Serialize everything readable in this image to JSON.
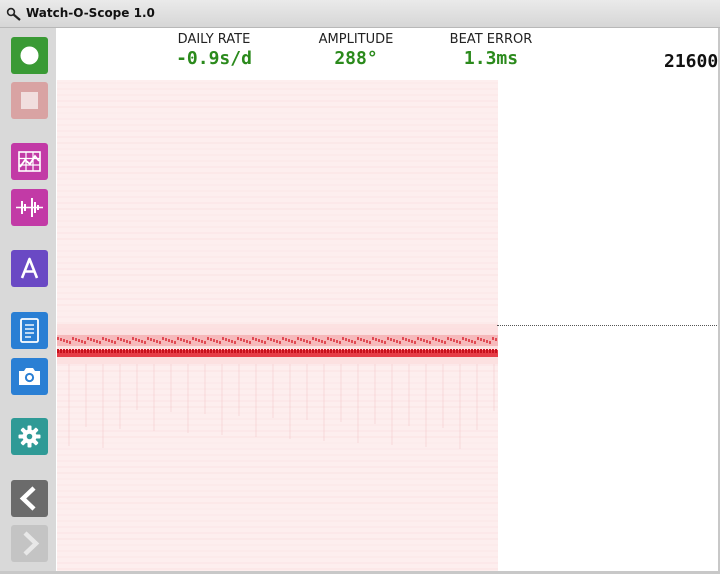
{
  "window": {
    "title": "Watch-O-Scope 1.0"
  },
  "readouts": {
    "daily_rate": {
      "label": "DAILY RATE",
      "value": "-0.9s/d"
    },
    "amplitude": {
      "label": "AMPLITUDE",
      "value": "288°"
    },
    "beat_error": {
      "label": "BEAT ERROR",
      "value": "1.3ms"
    },
    "bph": "21600"
  },
  "toolbar": [
    {
      "name": "record-button",
      "icon": "record-circle-icon",
      "color": "#3a9a35"
    },
    {
      "name": "stop-button",
      "icon": "stop-square-icon",
      "color": "#d99a9a",
      "disabled": true
    },
    {
      "name": "timegrapher-button",
      "icon": "grid-chart-icon",
      "color": "#c23aa6"
    },
    {
      "name": "waveform-button",
      "icon": "waveform-icon",
      "color": "#c23aa6"
    },
    {
      "name": "amplitude-button",
      "icon": "letter-a-icon",
      "color": "#6a49c4"
    },
    {
      "name": "report-button",
      "icon": "document-list-icon",
      "color": "#2a7fd4"
    },
    {
      "name": "screenshot-button",
      "icon": "camera-icon",
      "color": "#2a7fd4"
    },
    {
      "name": "settings-button",
      "icon": "gear-icon",
      "color": "#2f9a96"
    },
    {
      "name": "previous-button",
      "icon": "chevron-left-icon",
      "color": "#6b6b6b"
    },
    {
      "name": "next-button",
      "icon": "chevron-right-icon",
      "color": "#c4c4c4",
      "disabled": true
    }
  ],
  "colors": {
    "value_green": "#2b8a1c",
    "trace_red": "#e0202c",
    "plot_bg": "#fdeeee"
  }
}
